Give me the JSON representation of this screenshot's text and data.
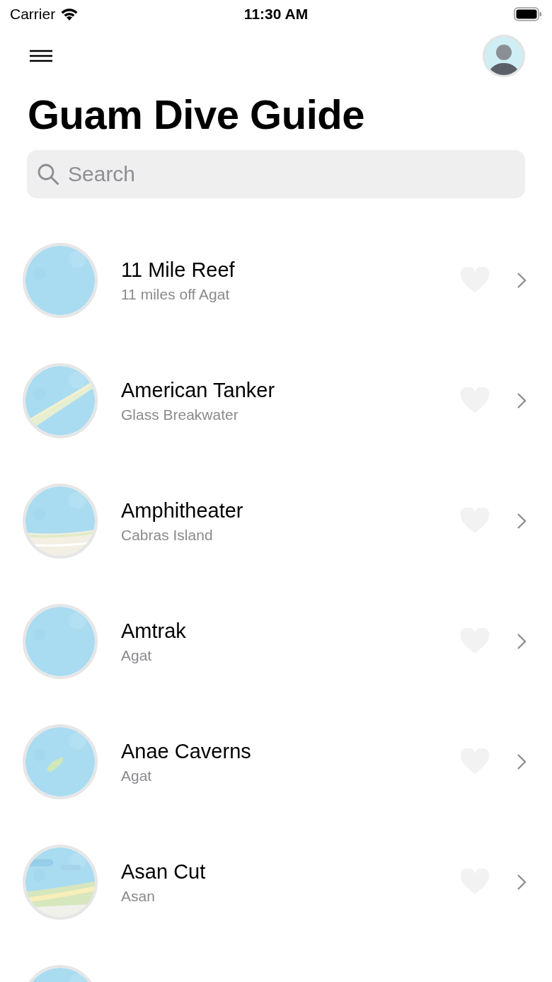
{
  "status_bar": {
    "carrier": "Carrier",
    "time": "11:30 AM"
  },
  "title": "Guam Dive Guide",
  "search": {
    "placeholder": "Search"
  },
  "sites": [
    {
      "name": "11 Mile Reef",
      "location": "11 miles off Agat",
      "favorite": false
    },
    {
      "name": "American Tanker",
      "location": "Glass Breakwater",
      "favorite": false
    },
    {
      "name": "Amphitheater",
      "location": "Cabras Island",
      "favorite": false
    },
    {
      "name": "Amtrak",
      "location": "Agat",
      "favorite": false
    },
    {
      "name": "Anae Caverns",
      "location": "Agat",
      "favorite": false
    },
    {
      "name": "Asan Cut",
      "location": "Asan",
      "favorite": false
    }
  ]
}
